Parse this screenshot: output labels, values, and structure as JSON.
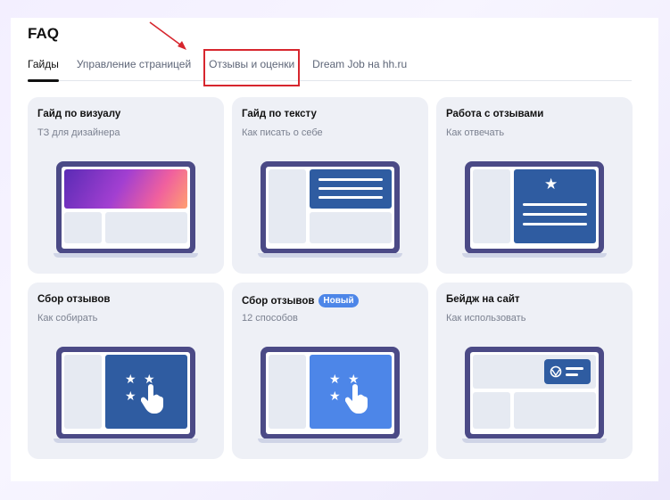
{
  "page": {
    "title": "FAQ",
    "accent_highlight": "#d7262e"
  },
  "tabs": [
    {
      "label": "Гайды",
      "active": true
    },
    {
      "label": "Управление страницей"
    },
    {
      "label": "Отзывы и оценки",
      "highlighted": true
    },
    {
      "label": "Dream Job на hh.ru"
    }
  ],
  "cards": [
    {
      "title": "Гайд по визуалу",
      "subtitle": "ТЗ для дизайнера",
      "icon": "laptop-gradient-illustration"
    },
    {
      "title": "Гайд по тексту",
      "subtitle": "Как писать о себе",
      "icon": "laptop-text-illustration"
    },
    {
      "title": "Работа с отзывами",
      "subtitle": "Как отвечать",
      "icon": "laptop-review-star-illustration"
    },
    {
      "title": "Сбор отзывов",
      "subtitle": "Как собирать",
      "icon": "laptop-stars-tap-illustration"
    },
    {
      "title": "Сбор отзывов",
      "badge": "Новый",
      "subtitle": "12 способов",
      "icon": "laptop-stars-tap-blue-illustration"
    },
    {
      "title": "Бейдж на сайт",
      "subtitle": "Как использовать",
      "icon": "laptop-badge-illustration"
    }
  ]
}
